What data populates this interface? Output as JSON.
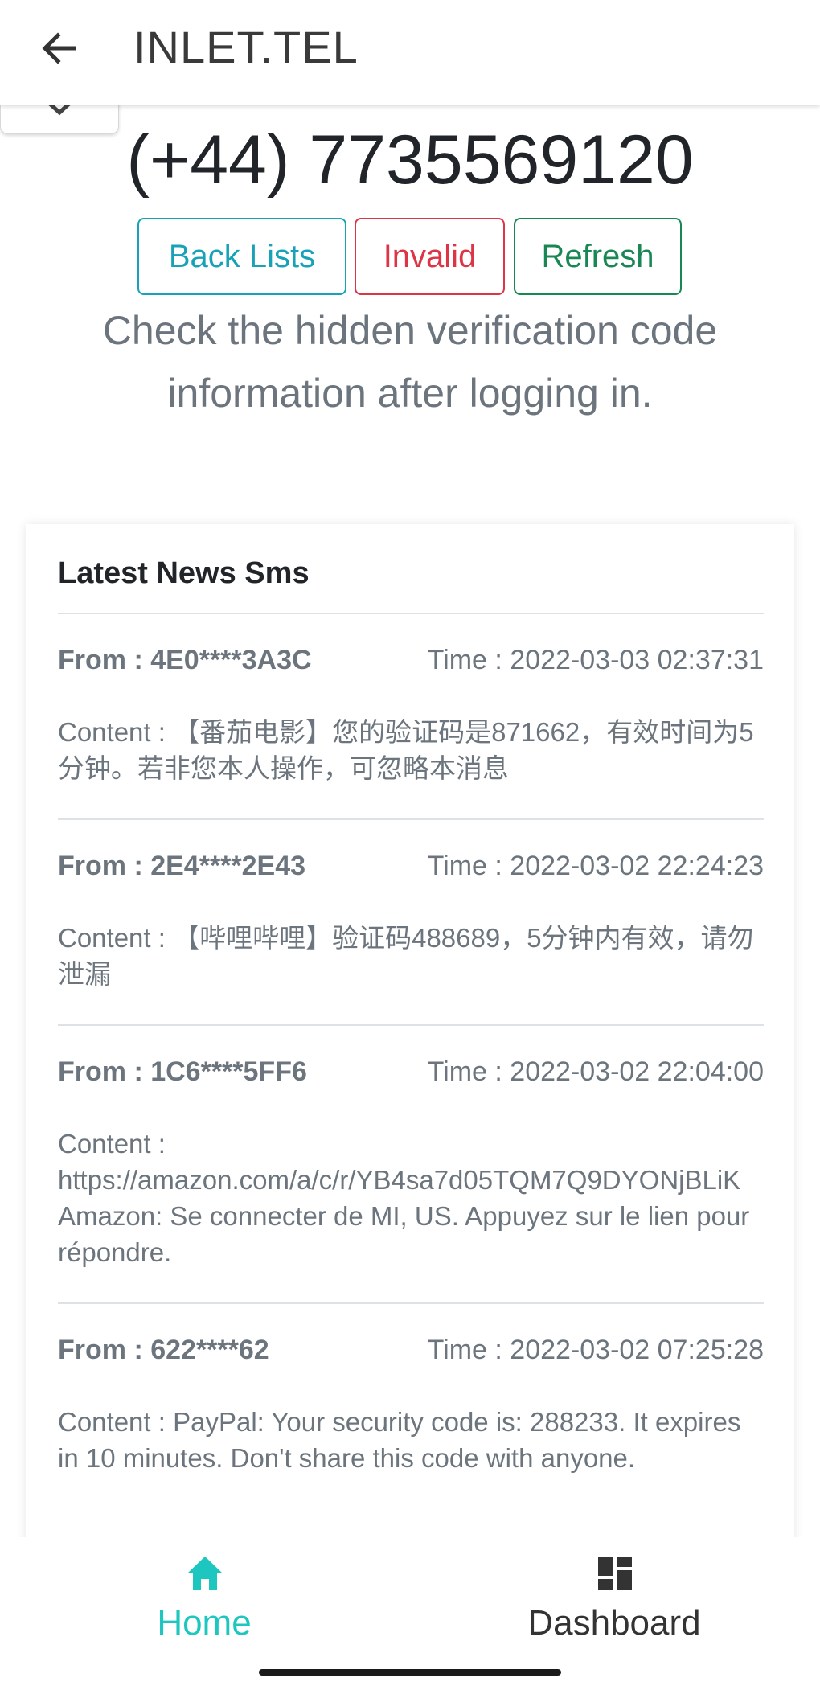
{
  "appbar": {
    "title": "INLET.TEL"
  },
  "phone_number": "(+44) 7735569120",
  "buttons": {
    "back_lists": "Back Lists",
    "invalid": "Invalid",
    "refresh": "Refresh"
  },
  "notice": "Check the hidden verification code information after logging in.",
  "card": {
    "title": "Latest News Sms",
    "messages": [
      {
        "from": "From : 4E0****3A3C",
        "time": "Time : 2022-03-03 02:37:31",
        "content": "Content : 【番茄电影】您的验证码是871662，有效时间为5分钟。若非您本人操作，可忽略本消息"
      },
      {
        "from": "From : 2E4****2E43",
        "time": "Time : 2022-03-02 22:24:23",
        "content": "Content : 【哔哩哔哩】验证码488689，5分钟内有效，请勿泄漏"
      },
      {
        "from": "From : 1C6****5FF6",
        "time": "Time : 2022-03-02 22:04:00",
        "content_label": "Content :",
        "content_url": "https://amazon.com/a/c/r/YB4sa7d05TQM7Q9DYONjBLiK",
        "content_rest": "Amazon: Se connecter de MI, US. Appuyez sur le lien pour répondre."
      },
      {
        "from": "From : 622****62",
        "time": "Time : 2022-03-02 07:25:28",
        "content": "Content : PayPal: Your security code is: 288233. It expires in 10 minutes. Don't share this code with anyone."
      }
    ]
  },
  "bottom_nav": {
    "home_label": "Home",
    "dashboard_label": "Dashboard"
  },
  "colors": {
    "accent": "#1dc7c0",
    "info": "#17a2b8",
    "danger": "#dc3545",
    "success": "#198754"
  }
}
